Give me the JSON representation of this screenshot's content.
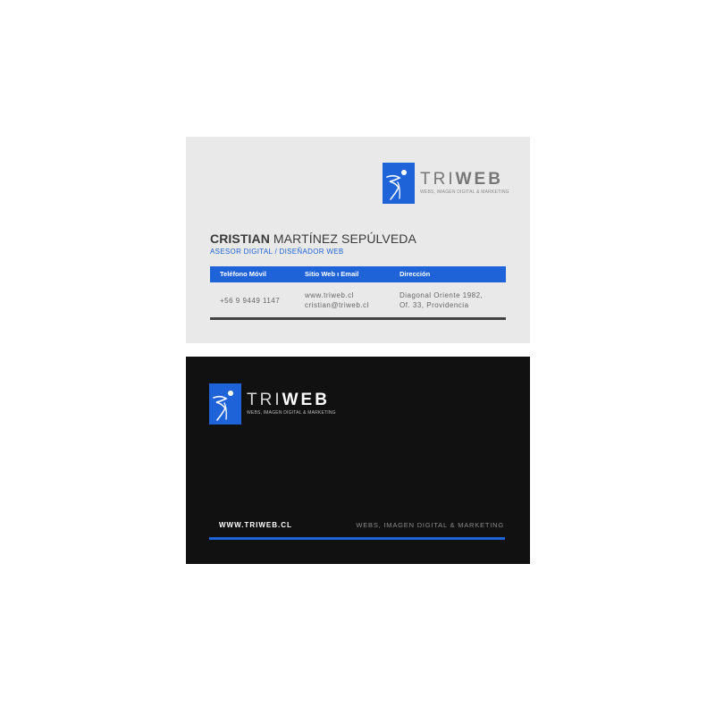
{
  "colors": {
    "accent": "#1e63d8",
    "front_bg": "#e9e9e9",
    "back_bg": "#111111"
  },
  "logo": {
    "icon": "triweb-logo-mark-icon",
    "word_light": "TRI",
    "word_bold": "WEB",
    "tagline": "WEBS, IMAGEN DIGITAL & MARKETING"
  },
  "front": {
    "first_name": "CRISTIAN",
    "last_name": "MARTÍNEZ SEPÚLVEDA",
    "role": "ASESOR DIGITAL / DISEÑADOR WEB",
    "columns": [
      {
        "header": "Teléfono Móvil",
        "lines": [
          "+56 9 9449 1147"
        ]
      },
      {
        "header": "Sitio Web ı Email",
        "lines": [
          "www.triweb.cl",
          "cristian@triweb.cl"
        ]
      },
      {
        "header": "Dirección",
        "lines": [
          "Diagonal Oriente 1982,",
          "Of. 33, Providencia"
        ]
      }
    ]
  },
  "back": {
    "url": "WWW.TRIWEB.CL",
    "tagline": "WEBS, IMAGEN DIGITAL & MARKETING"
  }
}
